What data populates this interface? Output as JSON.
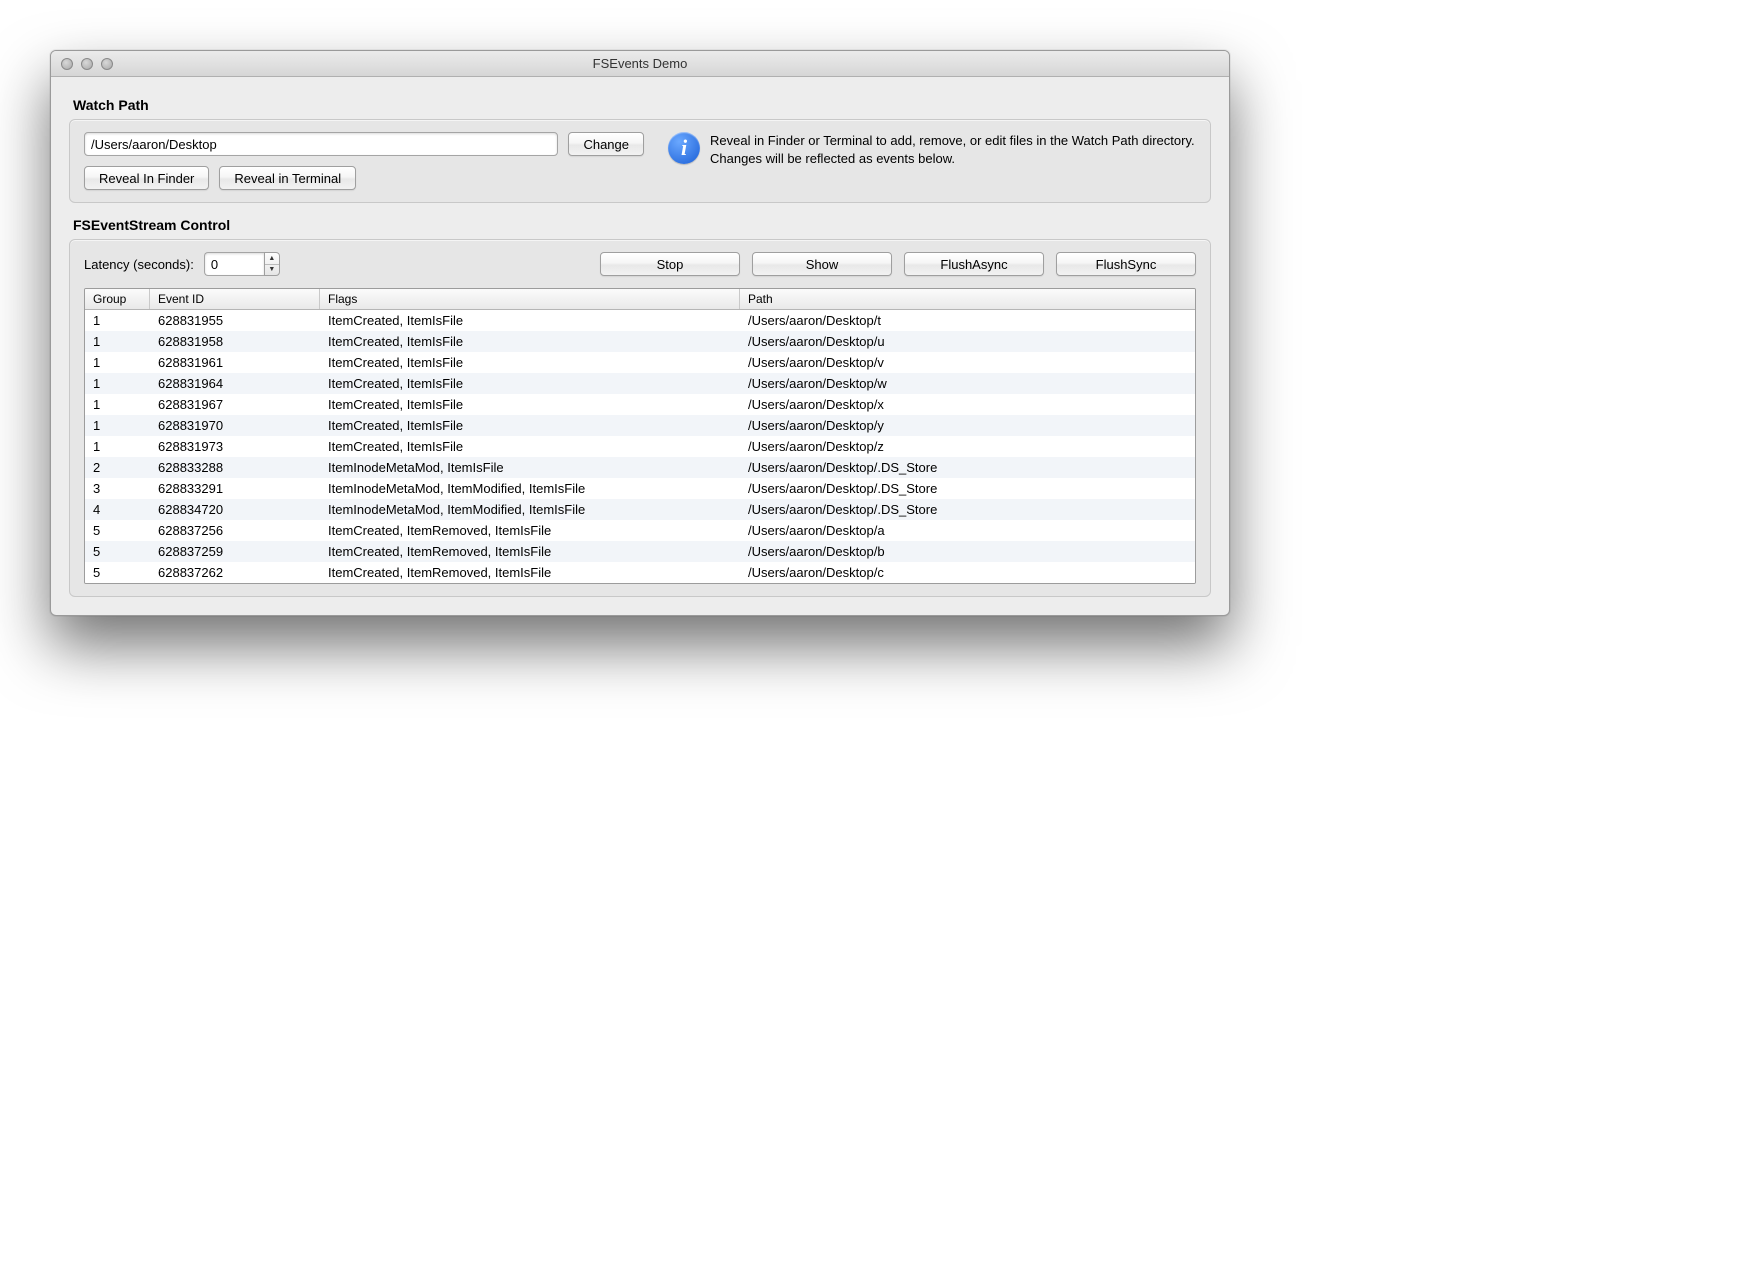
{
  "window": {
    "title": "FSEvents Demo"
  },
  "watch": {
    "section_label": "Watch Path",
    "path_value": "/Users/aaron/Desktop",
    "change_label": "Change",
    "reveal_finder_label": "Reveal In Finder",
    "reveal_terminal_label": "Reveal in Terminal",
    "info_text": "Reveal in Finder or Terminal to add, remove, or edit files in the Watch Path directory. Changes will be reflected as events below."
  },
  "control": {
    "section_label": "FSEventStream Control",
    "latency_label": "Latency (seconds):",
    "latency_value": "0",
    "buttons": {
      "stop": "Stop",
      "show": "Show",
      "flush_async": "FlushAsync",
      "flush_sync": "FlushSync"
    }
  },
  "table": {
    "headers": {
      "group": "Group",
      "event_id": "Event ID",
      "flags": "Flags",
      "path": "Path"
    },
    "rows": [
      {
        "group": "1",
        "event_id": "628831955",
        "flags": "ItemCreated, ItemIsFile",
        "path": "/Users/aaron/Desktop/t"
      },
      {
        "group": "1",
        "event_id": "628831958",
        "flags": "ItemCreated, ItemIsFile",
        "path": "/Users/aaron/Desktop/u"
      },
      {
        "group": "1",
        "event_id": "628831961",
        "flags": "ItemCreated, ItemIsFile",
        "path": "/Users/aaron/Desktop/v"
      },
      {
        "group": "1",
        "event_id": "628831964",
        "flags": "ItemCreated, ItemIsFile",
        "path": "/Users/aaron/Desktop/w"
      },
      {
        "group": "1",
        "event_id": "628831967",
        "flags": "ItemCreated, ItemIsFile",
        "path": "/Users/aaron/Desktop/x"
      },
      {
        "group": "1",
        "event_id": "628831970",
        "flags": "ItemCreated, ItemIsFile",
        "path": "/Users/aaron/Desktop/y"
      },
      {
        "group": "1",
        "event_id": "628831973",
        "flags": "ItemCreated, ItemIsFile",
        "path": "/Users/aaron/Desktop/z"
      },
      {
        "group": "2",
        "event_id": "628833288",
        "flags": "ItemInodeMetaMod, ItemIsFile",
        "path": "/Users/aaron/Desktop/.DS_Store"
      },
      {
        "group": "3",
        "event_id": "628833291",
        "flags": "ItemInodeMetaMod, ItemModified, ItemIsFile",
        "path": "/Users/aaron/Desktop/.DS_Store"
      },
      {
        "group": "4",
        "event_id": "628834720",
        "flags": "ItemInodeMetaMod, ItemModified, ItemIsFile",
        "path": "/Users/aaron/Desktop/.DS_Store"
      },
      {
        "group": "5",
        "event_id": "628837256",
        "flags": "ItemCreated, ItemRemoved, ItemIsFile",
        "path": "/Users/aaron/Desktop/a"
      },
      {
        "group": "5",
        "event_id": "628837259",
        "flags": "ItemCreated, ItemRemoved, ItemIsFile",
        "path": "/Users/aaron/Desktop/b"
      },
      {
        "group": "5",
        "event_id": "628837262",
        "flags": "ItemCreated, ItemRemoved, ItemIsFile",
        "path": "/Users/aaron/Desktop/c"
      }
    ]
  }
}
